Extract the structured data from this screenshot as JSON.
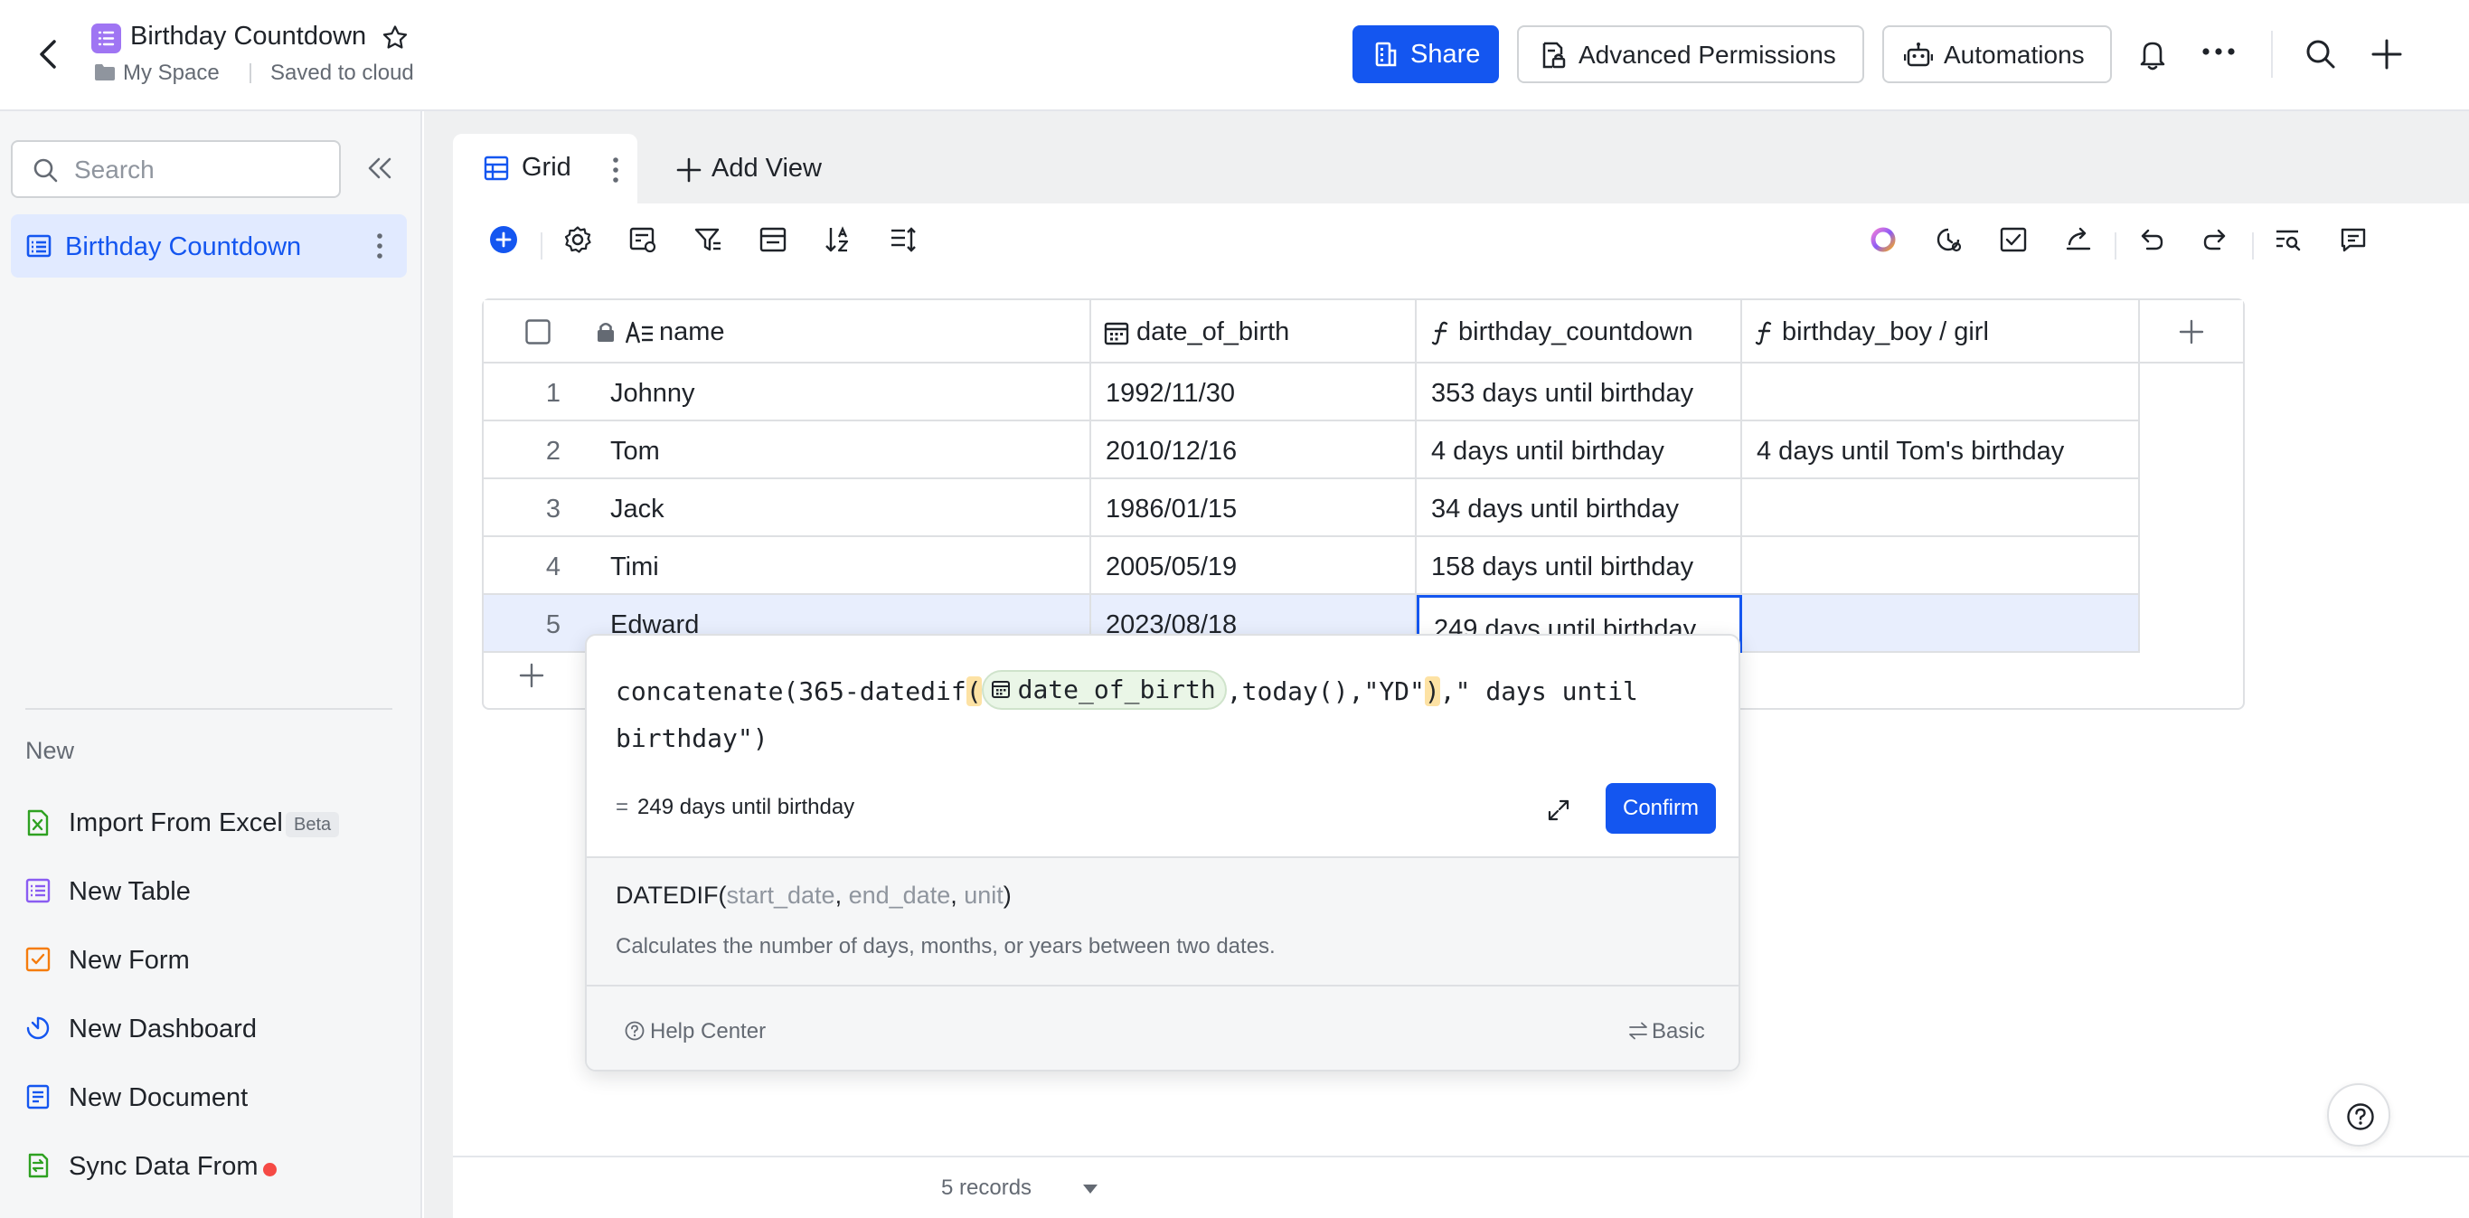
{
  "header": {
    "title": "Birthday Countdown",
    "space": "My Space",
    "save_status": "Saved to cloud",
    "share_label": "Share",
    "permissions_label": "Advanced Permissions",
    "automations_label": "Automations"
  },
  "sidebar": {
    "search_placeholder": "Search",
    "active_table": "Birthday Countdown",
    "new_section_label": "New",
    "new_items": [
      {
        "label": "Import From Excel",
        "badge": "Beta",
        "icon": "excel-icon"
      },
      {
        "label": "New Table",
        "icon": "table-icon"
      },
      {
        "label": "New Form",
        "icon": "form-icon"
      },
      {
        "label": "New Dashboard",
        "icon": "dashboard-icon"
      },
      {
        "label": "New Document",
        "icon": "document-icon"
      },
      {
        "label": "Sync Data From",
        "icon": "sync-icon"
      }
    ]
  },
  "views": {
    "active_tab": "Grid",
    "add_view_label": "Add View"
  },
  "grid": {
    "columns": [
      {
        "label": "name",
        "icon": "text-field-icon"
      },
      {
        "label": "date_of_birth",
        "icon": "date-field-icon"
      },
      {
        "label": "birthday_countdown",
        "icon": "formula-field-icon"
      },
      {
        "label": "birthday_boy / girl",
        "icon": "formula-field-icon"
      }
    ],
    "rows": [
      {
        "num": "1",
        "name": "Johnny",
        "dob": "1992/11/30",
        "countdown": "353 days until birthday",
        "boy_girl": ""
      },
      {
        "num": "2",
        "name": "Tom",
        "dob": "2010/12/16",
        "countdown": "4 days until birthday",
        "boy_girl": "4 days until Tom's birthday"
      },
      {
        "num": "3",
        "name": "Jack",
        "dob": "1986/01/15",
        "countdown": "34 days until birthday",
        "boy_girl": ""
      },
      {
        "num": "4",
        "name": "Timi",
        "dob": "2005/05/19",
        "countdown": "158 days until birthday",
        "boy_girl": ""
      },
      {
        "num": "5",
        "name": "Edward",
        "dob": "2023/08/18",
        "countdown": "249 days until birthday",
        "boy_girl": ""
      }
    ]
  },
  "formula_popup": {
    "part1": "concatenate(365-datedif",
    "paren_open": "(",
    "field": "date_of_birth",
    "part2": ",today(),\"YD\"",
    "paren_close": ")",
    "part3": ",\" days until birthday\")",
    "result_prefix": "=",
    "result": "249 days until birthday",
    "confirm_label": "Confirm",
    "fn_name": "DATEDIF(",
    "fn_param1": "start_date",
    "fn_sep1": ", ",
    "fn_param2": "end_date",
    "fn_sep2": ", ",
    "fn_param3": "unit",
    "fn_close": ")",
    "fn_description": "Calculates the number of days, months, or years between two dates.",
    "help_label": "Help Center",
    "mode_label": "Basic"
  },
  "footer": {
    "records": "5 records"
  },
  "colors": {
    "accent": "#1456f0",
    "selected_row": "#e8eefd",
    "sidebar_bg": "#f5f6f7",
    "paren_highlight": "#fde2a4",
    "field_chip": "#eaf6e7"
  }
}
